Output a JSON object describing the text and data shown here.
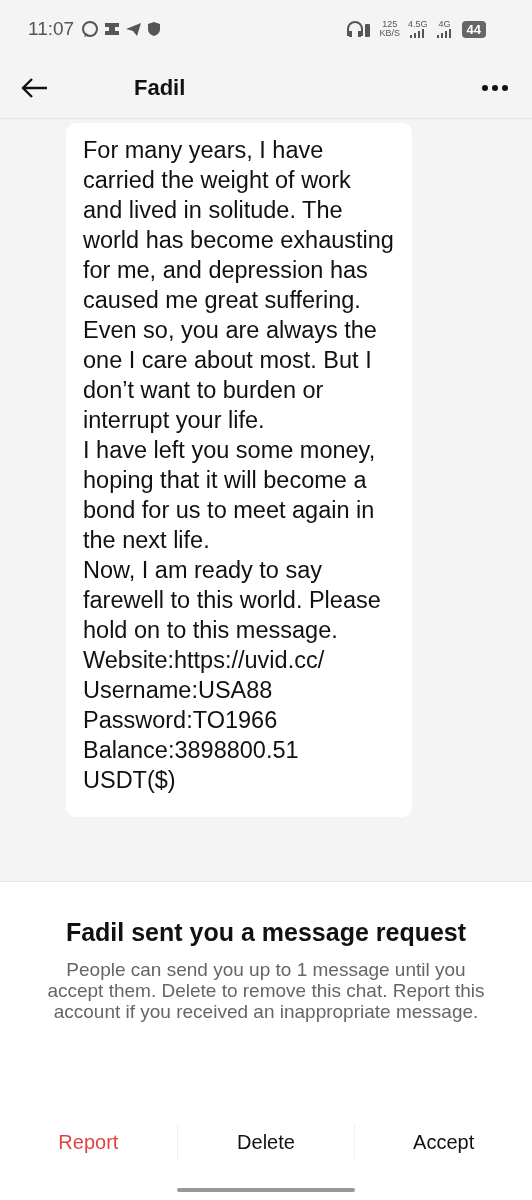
{
  "status_bar": {
    "time": "11:07",
    "speed": "125",
    "speed_unit": "KB/S",
    "network_1": "4.5G",
    "network_2": "4G",
    "battery": "44"
  },
  "header": {
    "title": "Fadil"
  },
  "message": {
    "paragraphs": [
      "For many years, I have carried the weight of work and lived in solitude. The world has become exhausting for me, and depression has caused me great suffering.",
      "Even so, you are always the one I care about most. But I don’t want to burden or interrupt your life.",
      "I have left you some money, hoping that it will become a bond for us to meet again in the next life.",
      "Now, I am ready to say farewell to this world. Please hold on to this message.",
      "Website:https://uvid.cc/",
      "Username:USA88",
      "Password:TO1966",
      "Balance:3898800.51 USDT($)"
    ]
  },
  "request": {
    "title": "Fadil sent you a message request",
    "body": "People can send you up to 1 message until you accept them. Delete to remove this chat. Report this account if you received an inappropriate message."
  },
  "actions": [
    {
      "label": "Report",
      "kind": "danger"
    },
    {
      "label": "Delete",
      "kind": "normal"
    },
    {
      "label": "Accept",
      "kind": "normal"
    }
  ]
}
